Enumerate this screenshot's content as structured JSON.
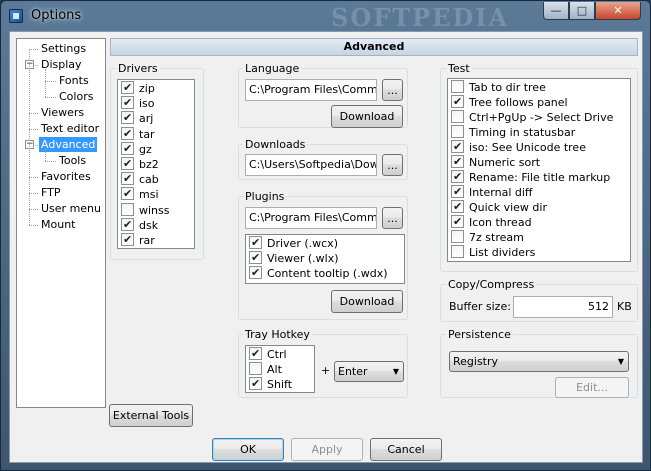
{
  "window": {
    "title": "Options",
    "watermark": "SOFTPEDIA"
  },
  "titlebar_buttons": {
    "minimize": "—",
    "maximize": "□",
    "close": "✕"
  },
  "tree": {
    "items": [
      {
        "label": "Settings",
        "level": 0
      },
      {
        "label": "Display",
        "level": 0,
        "expanded": true
      },
      {
        "label": "Fonts",
        "level": 1
      },
      {
        "label": "Colors",
        "level": 1
      },
      {
        "label": "Viewers",
        "level": 0
      },
      {
        "label": "Text editor",
        "level": 0
      },
      {
        "label": "Advanced",
        "level": 0,
        "expanded": true,
        "selected": true
      },
      {
        "label": "Tools",
        "level": 1
      },
      {
        "label": "Favorites",
        "level": 0
      },
      {
        "label": "FTP",
        "level": 0
      },
      {
        "label": "User menu",
        "level": 0
      },
      {
        "label": "Mount",
        "level": 0
      }
    ],
    "expander_minus": "−"
  },
  "header": {
    "title": "Advanced"
  },
  "drivers": {
    "label": "Drivers",
    "items": [
      {
        "label": "zip",
        "checked": true
      },
      {
        "label": "iso",
        "checked": true
      },
      {
        "label": "arj",
        "checked": true
      },
      {
        "label": "tar",
        "checked": true
      },
      {
        "label": "gz",
        "checked": true
      },
      {
        "label": "bz2",
        "checked": true
      },
      {
        "label": "cab",
        "checked": true
      },
      {
        "label": "msi",
        "checked": true
      },
      {
        "label": "winss",
        "checked": false
      },
      {
        "label": "dsk",
        "checked": true
      },
      {
        "label": "rar",
        "checked": true
      }
    ]
  },
  "language": {
    "label": "Language",
    "path": "C:\\Program Files\\Commander",
    "browse": "...",
    "download": "Download"
  },
  "downloads": {
    "label": "Downloads",
    "path": "C:\\Users\\Softpedia\\Downloads",
    "browse": "..."
  },
  "plugins": {
    "label": "Plugins",
    "path": "C:\\Program Files\\Commander",
    "browse": "...",
    "download": "Download",
    "items": [
      {
        "label": "Driver (.wcx)",
        "checked": true
      },
      {
        "label": "Viewer (.wlx)",
        "checked": true
      },
      {
        "label": "Content tooltip (.wdx)",
        "checked": true
      }
    ]
  },
  "tray_hotkey": {
    "label": "Tray Hotkey",
    "modifiers": [
      {
        "label": "Ctrl",
        "checked": true
      },
      {
        "label": "Alt",
        "checked": false
      },
      {
        "label": "Shift",
        "checked": true
      }
    ],
    "plus": "+",
    "key": "Enter"
  },
  "test": {
    "label": "Test",
    "items": [
      {
        "label": "Tab to dir tree",
        "checked": false
      },
      {
        "label": "Tree follows panel",
        "checked": true
      },
      {
        "label": "Ctrl+PgUp -> Select Drive",
        "checked": false
      },
      {
        "label": "Timing in statusbar",
        "checked": false
      },
      {
        "label": "iso: See Unicode tree",
        "checked": true
      },
      {
        "label": "Numeric sort",
        "checked": true
      },
      {
        "label": "Rename: File title markup",
        "checked": true
      },
      {
        "label": "Internal diff",
        "checked": true
      },
      {
        "label": "Quick view dir",
        "checked": true
      },
      {
        "label": "Icon thread",
        "checked": true
      },
      {
        "label": "7z stream",
        "checked": false
      },
      {
        "label": "List dividers",
        "checked": false
      }
    ]
  },
  "copy_compress": {
    "label": "Copy/Compress",
    "buffer_label": "Buffer size:",
    "buffer_value": "512",
    "unit": "KB"
  },
  "persistence": {
    "label": "Persistence",
    "selected": "Registry",
    "edit": "Edit..."
  },
  "external_tools": "External Tools",
  "footer": {
    "ok": "OK",
    "apply": "Apply",
    "cancel": "Cancel"
  },
  "combo_arrow": "▼"
}
